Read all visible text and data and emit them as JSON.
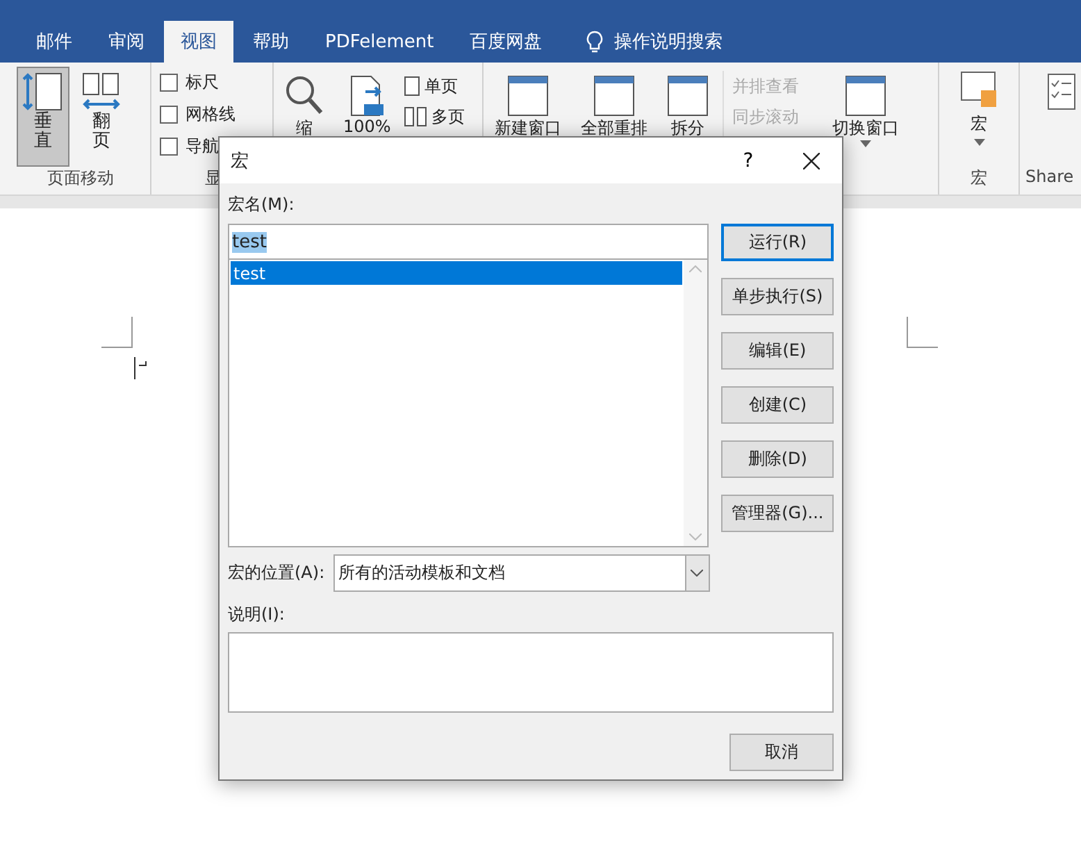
{
  "ribbon_tabs": [
    {
      "label": "邮件",
      "selected": false
    },
    {
      "label": "审阅",
      "selected": false
    },
    {
      "label": "视图",
      "selected": true
    },
    {
      "label": "帮助",
      "selected": false
    },
    {
      "label": "PDFelement",
      "selected": false
    },
    {
      "label": "百度网盘",
      "selected": false
    }
  ],
  "tell_me": {
    "label": "操作说明搜索"
  },
  "page_movement_group": {
    "label": "页面移动",
    "buttons": [
      {
        "label": "垂直",
        "selected": true
      },
      {
        "label": "翻页",
        "selected": false
      }
    ]
  },
  "show_group": {
    "label": "显",
    "checkboxes": [
      {
        "label": "标尺",
        "checked": false
      },
      {
        "label": "网格线",
        "checked": false
      },
      {
        "label": "导航",
        "checked": false
      }
    ]
  },
  "zoom_group": {
    "zoom": "缩",
    "hundred": "100%",
    "one_page": "单页",
    "multi_page": "多页"
  },
  "window_group": {
    "new_window": "新建窗口",
    "arrange_all": "全部重排",
    "split": "拆分",
    "side_by_side": {
      "label": "并排查看",
      "disabled": true
    },
    "sync_scroll": {
      "label": "同步滚动",
      "disabled": true
    },
    "switch_windows": "切换窗口"
  },
  "macros_group": {
    "button": "宏",
    "label": "宏"
  },
  "share_group": {
    "label": "Share"
  },
  "dialog": {
    "title": "宏",
    "help": "?",
    "name_label": "宏名(M):",
    "name_value": "test",
    "macros": [
      {
        "name": "test",
        "selected": true
      }
    ],
    "buttons": [
      {
        "label": "运行(R)",
        "default": true
      },
      {
        "label": "单步执行(S)",
        "default": false
      },
      {
        "label": "编辑(E)",
        "default": false
      },
      {
        "label": "创建(C)",
        "default": false
      },
      {
        "label": "删除(D)",
        "default": false
      },
      {
        "label": "管理器(G)...",
        "default": false
      }
    ],
    "location_label": "宏的位置(A):",
    "location_value": "所有的活动模板和文档",
    "description_label": "说明(I):",
    "cancel": "取消"
  }
}
